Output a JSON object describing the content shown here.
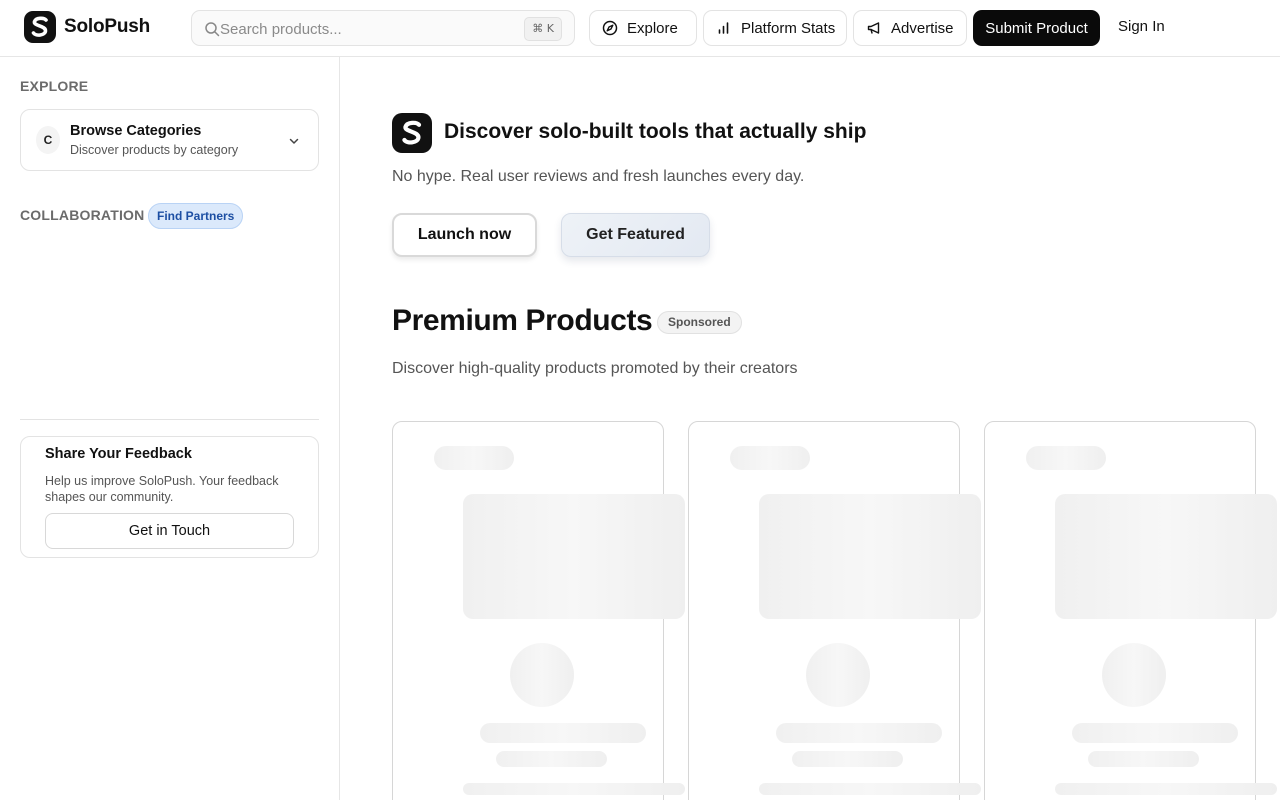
{
  "header": {
    "brand": "SoloPush",
    "search_placeholder": "Search products...",
    "search_shortcut": "⌘ K",
    "nav": {
      "explore": "Explore",
      "platform_stats": "Platform Stats",
      "advertise": "Advertise"
    },
    "submit_label": "Submit Product",
    "signin_label": "Sign In"
  },
  "sidebar": {
    "explore_label": "EXPLORE",
    "categories": {
      "badge": "C",
      "title": "Browse Categories",
      "subtitle": "Discover products by category"
    },
    "collaboration_label": "COLLABORATION",
    "partners_badge": "Find Partners",
    "feedback": {
      "title": "Share Your Feedback",
      "text": "Help us improve SoloPush. Your feedback shapes our community.",
      "button": "Get in Touch"
    }
  },
  "hero": {
    "title": "Discover solo-built tools that actually ship",
    "subtitle": "No hype. Real user reviews and fresh launches every day.",
    "launch_label": "Launch now",
    "featured_label": "Get Featured"
  },
  "premium": {
    "title": "Premium Products",
    "badge": "Sponsored",
    "subtitle": "Discover high-quality products promoted by their creators"
  },
  "colors": {
    "brand": "#111111",
    "accent_blue": "#1d4fa3",
    "partners_bg": "#dbe9fb"
  },
  "icons": [
    "logo-s-icon",
    "search-icon",
    "compass-icon",
    "bar-chart-icon",
    "megaphone-icon",
    "chevron-down-icon"
  ]
}
